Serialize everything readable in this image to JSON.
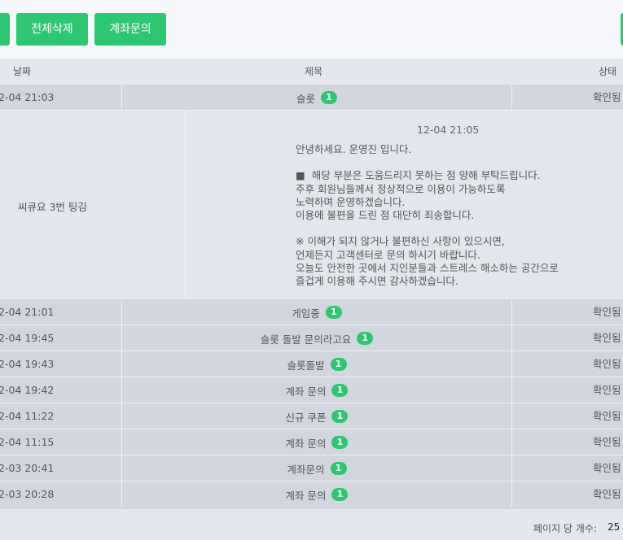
{
  "toolbar": {
    "delete_all_label": "전체삭제",
    "account_inquiry_label": "계좌문의"
  },
  "table": {
    "headers": {
      "date": "날짜",
      "title": "제목",
      "status": "상태"
    },
    "rows_top": [
      {
        "date": "2-04 21:03",
        "title": "슬롯",
        "badge": "1",
        "status": "확인됨"
      }
    ],
    "detail": {
      "subject": "씨큐요 3번 팅김",
      "time": "12-04 21:05",
      "body": "안녕하세요. 운영진 입니다.\n\n■  해당 부분은 도움드리지 못하는 점 양해 부탁드립니다.\n주후 회원님들께서 정상적으로 이용이 가능하도록\n노력하며 운영하겠습니다.\n이용에 불편을 드린 점 대단히 죄송합니다.\n\n※ 이해가 되지 않거나 불편하신 사항이 있으시면,\n언제든지 고객센터로 문의 하시기 바랍니다.\n오늘도 안전한 곳에서 지인분들과 스트레스 해소하는 공간으로\n즐겁게 이용해 주시면 감사하겠습니다."
    },
    "rows_bottom": [
      {
        "date": "2-04 21:01",
        "title": "게임중",
        "badge": "1",
        "status": "확인됨"
      },
      {
        "date": "2-04 19:45",
        "title": "슬롯 돌발 문의라고요",
        "badge": "1",
        "status": "확인됨"
      },
      {
        "date": "2-04 19:43",
        "title": "슬롯돌발",
        "badge": "1",
        "status": "확인됨"
      },
      {
        "date": "2-04 19:42",
        "title": "계좌 문의",
        "badge": "1",
        "status": "확인됨"
      },
      {
        "date": "2-04 11:22",
        "title": "신규 쿠폰",
        "badge": "1",
        "status": "확인됨"
      },
      {
        "date": "2-04 11:15",
        "title": "계좌 문의",
        "badge": "1",
        "status": "확인됨"
      },
      {
        "date": "2-03 20:41",
        "title": "계좌문의",
        "badge": "1",
        "status": "확인됨"
      },
      {
        "date": "2-03 20:28",
        "title": "계좌 문의",
        "badge": "1",
        "status": "확인됨"
      }
    ]
  },
  "footer": {
    "per_page_label": "페이지 당 개수:",
    "per_page_value": "25"
  },
  "colors": {
    "accent": "#2ec771",
    "row_bg": "#d2d6de",
    "header_bg": "#e4e7ee"
  }
}
